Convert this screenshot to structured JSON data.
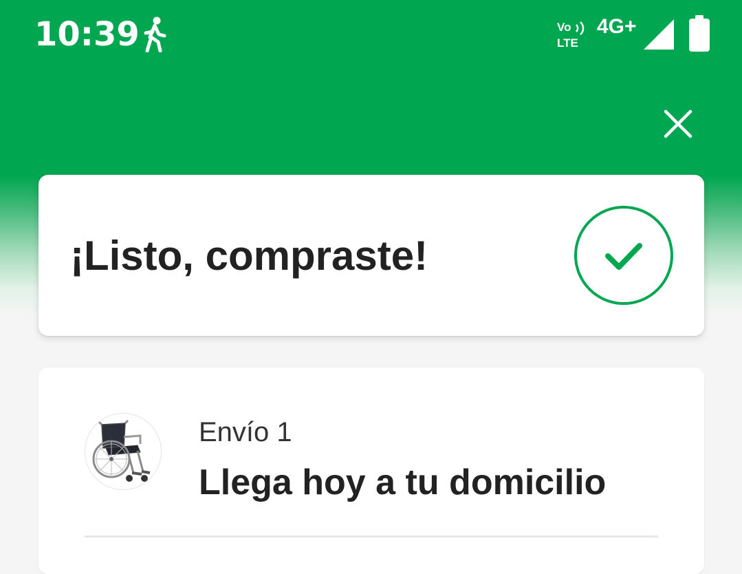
{
  "status_bar": {
    "time": "10:39",
    "activity_icon": "walking-person-icon",
    "volte_top": "Vo",
    "volte_bottom": "LTE",
    "network": "4G+",
    "signal_icon": "signal-strength-icon",
    "battery_icon": "battery-icon"
  },
  "header": {
    "close_icon": "close-icon"
  },
  "success_card": {
    "title": "¡Listo, compraste!",
    "icon": "check-circle-icon"
  },
  "shipment": {
    "label": "Envío 1",
    "title": "Llega hoy a tu domicilio",
    "product_image": "wheelchair-image"
  },
  "colors": {
    "brand_green": "#00a650",
    "text_dark": "#222222",
    "background": "#f5f5f5"
  }
}
